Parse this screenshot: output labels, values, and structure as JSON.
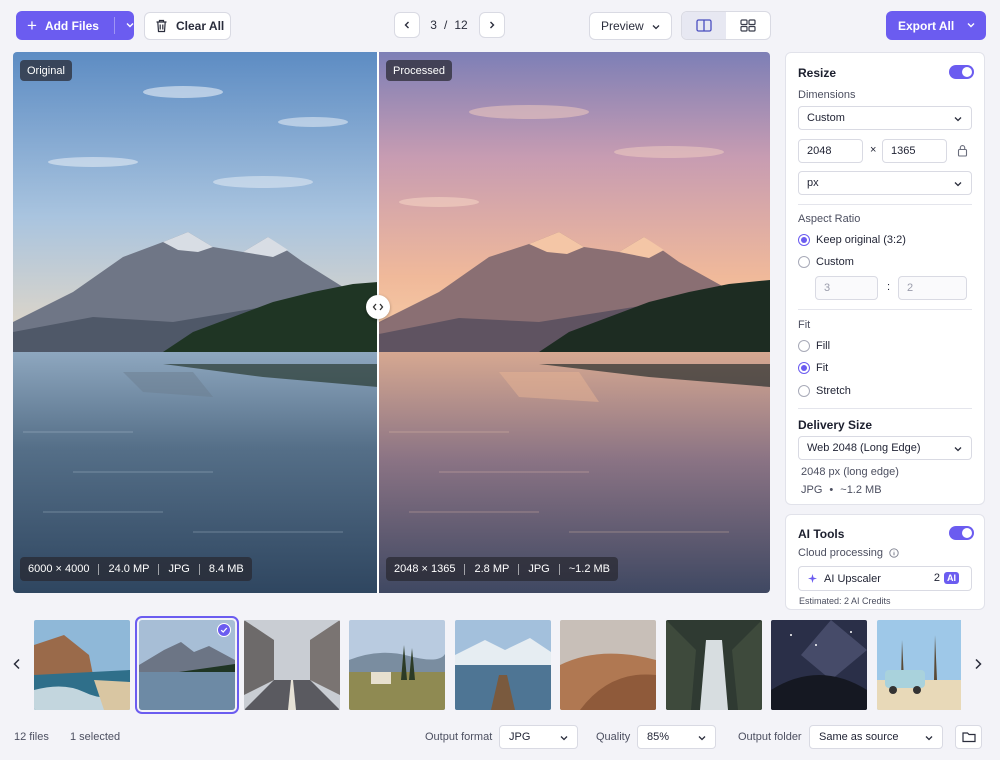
{
  "toolbar": {
    "add_files_label": "Add Files",
    "clear_all_label": "Clear All",
    "pager_current": "3",
    "pager_sep": "/",
    "pager_total": "12",
    "preview_label": "Preview",
    "export_all_label": "Export All"
  },
  "viewer": {
    "original_tag": "Original",
    "processed_tag": "Processed",
    "original_info": [
      "6000 × 4000",
      "24.0 MP",
      "JPG",
      "8.4 MB"
    ],
    "processed_info": [
      "2048 × 1365",
      "2.8 MP",
      "JPG",
      "~1.2 MB"
    ]
  },
  "resize": {
    "title": "Resize",
    "dimensions_label": "Dimensions",
    "dimensions_value": "Custom",
    "width": "2048",
    "times": "×",
    "height": "1365",
    "unit": "px",
    "aspect_label": "Aspect Ratio",
    "aspect_options": [
      "Keep original (3:2)",
      "Custom"
    ],
    "ratio_w": "3",
    "ratio_sep": ":",
    "ratio_h": "2",
    "fit_label": "Fit",
    "fit_options": [
      "Fill",
      "Fit",
      "Stretch"
    ],
    "delivery_title": "Delivery Size",
    "delivery_value": "Web 2048 (Long Edge)",
    "delivery_line1": "2048 px (long edge)",
    "delivery_format": "JPG",
    "delivery_bullet": "•",
    "delivery_size": "~1.2 MB"
  },
  "ai_tools": {
    "title": "AI Tools",
    "subtitle": "Cloud processing",
    "upscaler_label": "AI Upscaler",
    "upscaler_count": "2",
    "upscaler_badge": "AI",
    "estimate": "Estimated:  2 AI Credits"
  },
  "footer": {
    "files_count": "12 files",
    "selected_count": "1 selected",
    "output_format_label": "Output format",
    "output_format_value": "JPG",
    "quality_label": "Quality",
    "quality_value": "85%",
    "output_folder_label": "Output folder",
    "output_folder_value": "Same as source"
  },
  "colors": {
    "accent": "#6b5cf0",
    "background": "#f3f3f8"
  },
  "icons": [
    "plus-icon",
    "chevron-down-icon",
    "trash-icon",
    "chevron-left-icon",
    "chevron-right-icon",
    "split-view-icon",
    "grid-view-icon",
    "lock-icon",
    "info-icon",
    "sparkle-icon",
    "check-icon",
    "folder-icon"
  ]
}
